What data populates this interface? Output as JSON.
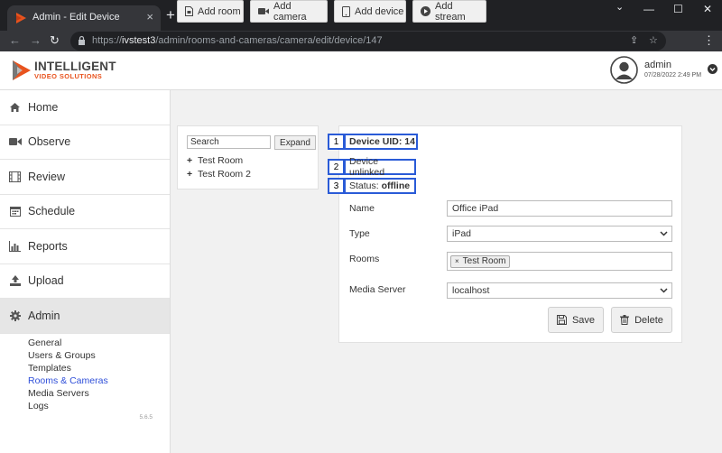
{
  "browser": {
    "tab_title": "Admin - Edit Device",
    "tab_close": "×",
    "new_tab": "+",
    "url_prefix": "https://",
    "url_host": "ivstest3",
    "url_path": "/admin/rooms-and-cameras/camera/edit/device/147",
    "win_min": "—",
    "win_max": "☐",
    "win_close": "✕",
    "win_chevron": "⌄"
  },
  "brand": {
    "line1": "INTELLIGENT",
    "line2": "VIDEO SOLUTIONS",
    "accent": "#e8531e"
  },
  "user": {
    "name": "admin",
    "datetime": "07/28/2022 2:49 PM"
  },
  "sidebar": {
    "items": [
      {
        "label": "Home",
        "icon": "home-icon"
      },
      {
        "label": "Observe",
        "icon": "video-icon"
      },
      {
        "label": "Review",
        "icon": "film-icon"
      },
      {
        "label": "Schedule",
        "icon": "calendar-icon"
      },
      {
        "label": "Reports",
        "icon": "bar-chart-icon"
      },
      {
        "label": "Upload",
        "icon": "upload-icon"
      },
      {
        "label": "Admin",
        "icon": "gear-icon"
      }
    ],
    "admin_sub": [
      "General",
      "Users & Groups",
      "Templates",
      "Rooms & Cameras",
      "Media Servers",
      "Logs"
    ],
    "active_sub": "Rooms & Cameras",
    "version": "5.6.5"
  },
  "toolbar": {
    "add_room": "Add room",
    "add_camera": "Add camera",
    "add_device": "Add device",
    "add_stream": "Add stream"
  },
  "tree": {
    "search_placeholder": "Search",
    "expand_label": "Expand",
    "rooms": [
      "Test Room",
      "Test Room 2"
    ]
  },
  "device": {
    "markers": [
      "1",
      "2",
      "3"
    ],
    "uid_label": "Device UID: 14",
    "link_status": "Device unlinked",
    "status_label": "Status:",
    "status_value": "offline",
    "fields": {
      "name_label": "Name",
      "name_value": "Office iPad",
      "type_label": "Type",
      "type_value": "iPad",
      "rooms_label": "Rooms",
      "rooms_tag": "Test Room",
      "rooms_tag_remove": "×",
      "media_label": "Media Server",
      "media_value": "localhost"
    },
    "save_label": "Save",
    "delete_label": "Delete",
    "highlight_color": "#2a5bd7"
  }
}
